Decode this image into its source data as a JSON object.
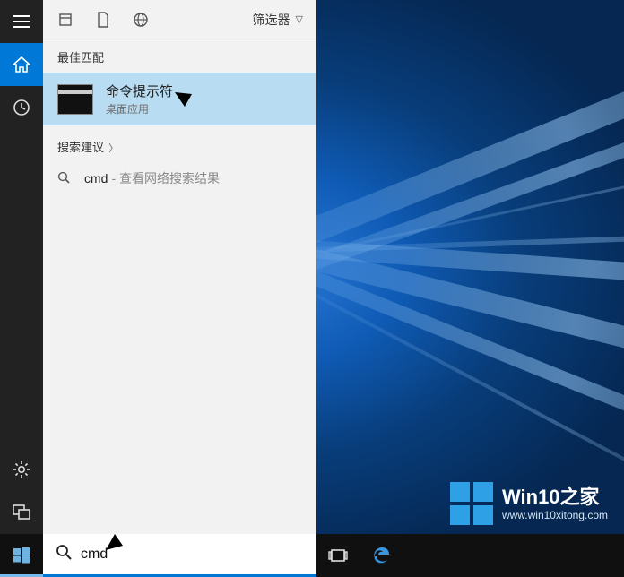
{
  "icons": {
    "hamburger": "hamburger-icon",
    "home": "home-icon",
    "settings": "gear-icon",
    "feedback": "feedback-icon",
    "clock": "clock-icon",
    "document": "document-icon",
    "globe": "globe-icon",
    "chevron_down": "chevron-down-icon",
    "search": "search-icon"
  },
  "panel": {
    "filter_label": "筛选器",
    "best_match_header": "最佳匹配",
    "best_match": {
      "title": "命令提示符",
      "subtitle": "桌面应用"
    },
    "suggestion_header": "搜索建议",
    "suggestions": [
      {
        "text": "cmd",
        "hint": "- 查看网络搜索结果"
      }
    ]
  },
  "search": {
    "value": "cmd",
    "placeholder": ""
  },
  "taskbar": {
    "start": "start-button",
    "task_view": "task-view-button",
    "edge": "edge-browser-button"
  },
  "watermark": {
    "brand_prefix": "Win",
    "brand_bold": "10",
    "brand_suffix": "之家",
    "url": "www.win10xitong.com"
  }
}
